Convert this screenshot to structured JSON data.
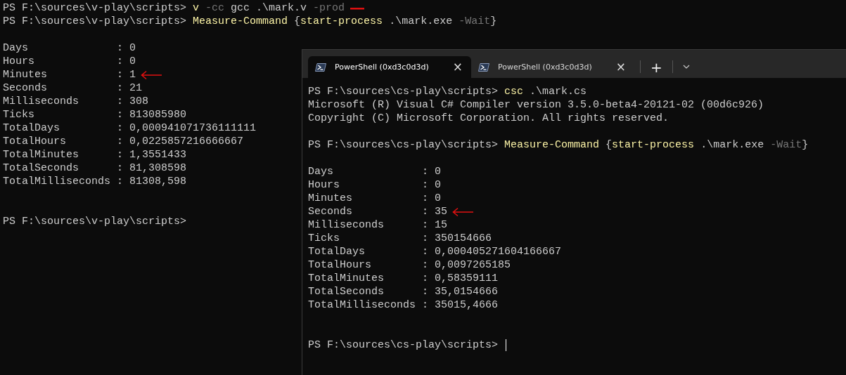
{
  "back_terminal": {
    "lines": [
      {
        "kind": "command",
        "marked": true,
        "tokens": [
          {
            "kind": "prompt",
            "text": "PS F:\\sources\\v-play\\scripts> "
          },
          {
            "kind": "cmd",
            "text": "v"
          },
          {
            "kind": "param",
            "text": " -cc"
          },
          {
            "kind": "arg",
            "text": " gcc"
          },
          {
            "kind": "arg",
            "text": " .\\mark.v"
          },
          {
            "kind": "param",
            "text": " -prod"
          }
        ]
      },
      {
        "kind": "command",
        "marked": false,
        "tokens": [
          {
            "kind": "prompt",
            "text": "PS F:\\sources\\v-play\\scripts> "
          },
          {
            "kind": "cmd",
            "text": "Measure-Command"
          },
          {
            "kind": "arg",
            "text": " {"
          },
          {
            "kind": "cmd",
            "text": "start-process"
          },
          {
            "kind": "arg",
            "text": " .\\mark.exe"
          },
          {
            "kind": "param",
            "text": " -Wait"
          },
          {
            "kind": "arg",
            "text": "}"
          }
        ]
      },
      {
        "kind": "blank"
      },
      {
        "kind": "stats",
        "separator": ":",
        "rows": [
          {
            "label": "Days",
            "value": "0",
            "marked": false
          },
          {
            "label": "Hours",
            "value": "0",
            "marked": false
          },
          {
            "label": "Minutes",
            "value": "1",
            "marked": true
          },
          {
            "label": "Seconds",
            "value": "21",
            "marked": false
          },
          {
            "label": "Milliseconds",
            "value": "308",
            "marked": false
          },
          {
            "label": "Ticks",
            "value": "813085980",
            "marked": false
          },
          {
            "label": "TotalDays",
            "value": "0,000941071736111111",
            "marked": false
          },
          {
            "label": "TotalHours",
            "value": "0,0225857216666667",
            "marked": false
          },
          {
            "label": "TotalMinutes",
            "value": "1,3551433",
            "marked": false
          },
          {
            "label": "TotalSeconds",
            "value": "81,308598",
            "marked": false
          },
          {
            "label": "TotalMilliseconds",
            "value": "81308,598",
            "marked": false
          }
        ]
      },
      {
        "kind": "blank"
      },
      {
        "kind": "blank"
      },
      {
        "kind": "command",
        "marked": false,
        "cursor": false,
        "tokens": [
          {
            "kind": "prompt",
            "text": "PS F:\\sources\\v-play\\scripts>"
          }
        ]
      }
    ]
  },
  "front_window": {
    "tabs": [
      {
        "title": "PowerShell (0xd3c0d3d)",
        "close": "×",
        "selected": true
      },
      {
        "title": "PowerShell (0xd3c0d3d)",
        "close": "×",
        "selected": false
      }
    ],
    "new_tab": "+",
    "lines": [
      {
        "kind": "command",
        "marked": false,
        "tokens": [
          {
            "kind": "prompt",
            "text": "PS F:\\sources\\cs-play\\scripts> "
          },
          {
            "kind": "cmd",
            "text": "csc"
          },
          {
            "kind": "arg",
            "text": " .\\mark.cs"
          }
        ]
      },
      {
        "kind": "output",
        "text": "Microsoft (R) Visual C# Compiler version 3.5.0-beta4-20121-02 (00d6c926)"
      },
      {
        "kind": "output",
        "text": "Copyright (C) Microsoft Corporation. All rights reserved."
      },
      {
        "kind": "blank"
      },
      {
        "kind": "command",
        "marked": false,
        "tokens": [
          {
            "kind": "prompt",
            "text": "PS F:\\sources\\cs-play\\scripts> "
          },
          {
            "kind": "cmd",
            "text": "Measure-Command"
          },
          {
            "kind": "arg",
            "text": " {"
          },
          {
            "kind": "cmd",
            "text": "start-process"
          },
          {
            "kind": "arg",
            "text": " .\\mark.exe"
          },
          {
            "kind": "param",
            "text": " -Wait"
          },
          {
            "kind": "arg",
            "text": "}"
          }
        ]
      },
      {
        "kind": "blank"
      },
      {
        "kind": "stats",
        "separator": ":",
        "rows": [
          {
            "label": "Days",
            "value": "0",
            "marked": false
          },
          {
            "label": "Hours",
            "value": "0",
            "marked": false
          },
          {
            "label": "Minutes",
            "value": "0",
            "marked": false
          },
          {
            "label": "Seconds",
            "value": "35",
            "marked": true
          },
          {
            "label": "Milliseconds",
            "value": "15",
            "marked": false
          },
          {
            "label": "Ticks",
            "value": "350154666",
            "marked": false
          },
          {
            "label": "TotalDays",
            "value": "0,000405271604166667",
            "marked": false
          },
          {
            "label": "TotalHours",
            "value": "0,0097265185",
            "marked": false
          },
          {
            "label": "TotalMinutes",
            "value": "0,58359111",
            "marked": false
          },
          {
            "label": "TotalSeconds",
            "value": "35,0154666",
            "marked": false
          },
          {
            "label": "TotalMilliseconds",
            "value": "35015,4666",
            "marked": false
          }
        ]
      },
      {
        "kind": "blank"
      },
      {
        "kind": "blank"
      },
      {
        "kind": "command",
        "marked": false,
        "cursor": true,
        "tokens": [
          {
            "kind": "prompt",
            "text": "PS F:\\sources\\cs-play\\scripts> "
          }
        ]
      }
    ]
  }
}
